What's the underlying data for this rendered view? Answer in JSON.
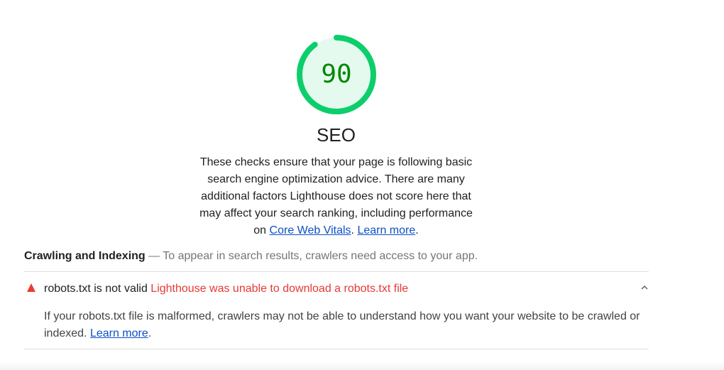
{
  "score": {
    "value": "90",
    "fraction": 0.9,
    "color": "#0cce6b",
    "bg_color": "#e5faef",
    "text_color": "#008800"
  },
  "category": {
    "title": "SEO",
    "description_before": "These checks ensure that your page is following basic search engine optimization advice. There are many additional factors Lighthouse does not score here that may affect your search ranking, including performance on ",
    "link_core_web_vitals": "Core Web Vitals",
    "between": ". ",
    "link_learn_more": "Learn more",
    "after": "."
  },
  "group": {
    "title": "Crawling and Indexing",
    "description": " — To appear in search results, crawlers need access to your app."
  },
  "audit": {
    "status_icon": "fail-triangle-icon",
    "status_color": "#eb3b2f",
    "title": "robots.txt is not valid",
    "display_value": "Lighthouse was unable to download a robots.txt file",
    "expanded": true,
    "chevron_icon": "chevron-up-icon",
    "detail_before": "If your robots.txt file is malformed, crawlers may not be able to understand how you want your website to be crawled or indexed. ",
    "detail_link": "Learn more",
    "detail_after": "."
  }
}
